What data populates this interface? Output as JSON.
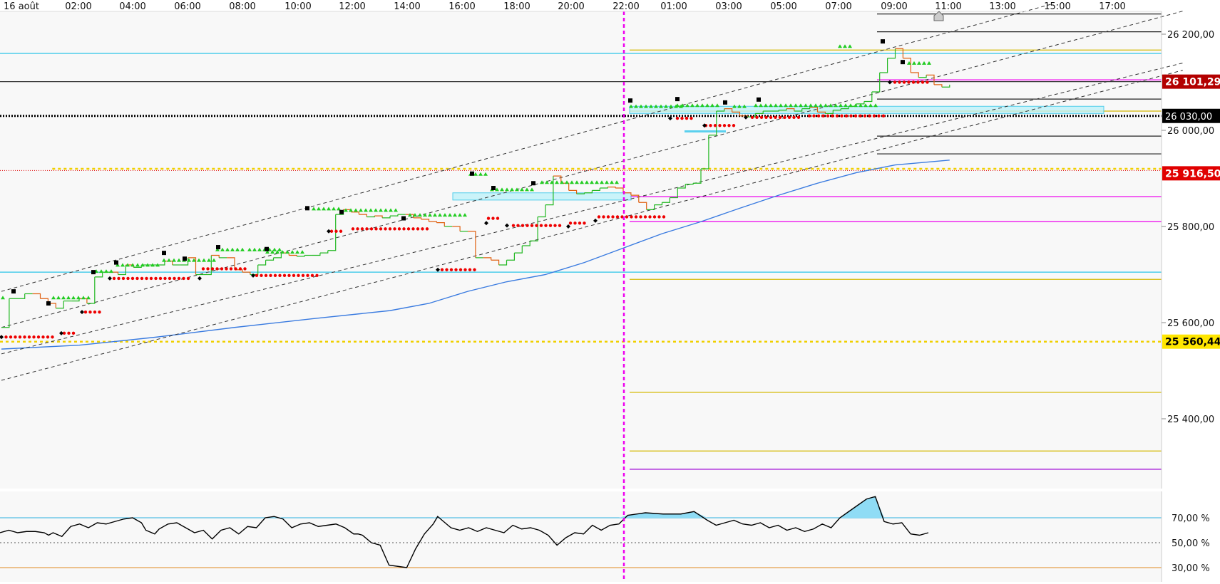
{
  "chart_data": {
    "type": "line",
    "x_tick_labels": [
      "16 août",
      "02:00",
      "04:00",
      "06:00",
      "08:00",
      "10:00",
      "12:00",
      "14:00",
      "16:00",
      "18:00",
      "20:00",
      "22:00",
      "01:00",
      "03:00",
      "05:00",
      "07:00",
      "09:00",
      "11:00",
      "13:00",
      "15:00",
      "17:00"
    ],
    "price_axis": {
      "tick_labels": [
        "26 200,00",
        "26 000,00",
        "25 800,00",
        "25 600,00",
        "25 400,00"
      ],
      "tick_values": [
        26200,
        26000,
        25800,
        25600,
        25400
      ]
    },
    "price_tags": [
      {
        "label": "26 101,29",
        "value": 26101.29,
        "bg": "#b30000",
        "fg": "#ffffff"
      },
      {
        "label": "26 030,00",
        "value": 26030,
        "bg": "#000000",
        "fg": "#ffffff"
      },
      {
        "label": "25 916,50",
        "value": 25916.5,
        "bg": "#e00000",
        "fg": "#ffffff"
      },
      {
        "label": "25 560,44",
        "value": 25560.44,
        "bg": "#ffe600",
        "fg": "#000000"
      }
    ],
    "horizontal_levels": [
      {
        "value": 26160,
        "color": "#2bc4e8",
        "style": "solid",
        "from": "start"
      },
      {
        "value": 26101.29,
        "color": "#333333",
        "style": "solid",
        "from": "start"
      },
      {
        "value": 26030,
        "color": "#000000",
        "style": "dotted-heavy",
        "from": "start"
      },
      {
        "value": 25920,
        "color": "#f0d000",
        "style": "dashed-yellow",
        "from": "x0.045"
      },
      {
        "value": 25916.5,
        "color": "#e00000",
        "style": "dotted-red",
        "from": "start"
      },
      {
        "value": 25705,
        "color": "#2bc4e8",
        "style": "solid",
        "from": "start"
      },
      {
        "value": 25560.44,
        "color": "#f0d000",
        "style": "dashed-yellow",
        "from": "start"
      },
      {
        "value": 26167,
        "color": "#d4b800",
        "style": "solid",
        "from": "session"
      },
      {
        "value": 26040,
        "color": "#d4b800",
        "style": "solid",
        "from": "session"
      },
      {
        "value": 25862,
        "color": "#ee00ee",
        "style": "solid",
        "from": "session"
      },
      {
        "value": 25810,
        "color": "#ee00ee",
        "style": "solid",
        "from": "session"
      },
      {
        "value": 25690,
        "color": "#d4b800",
        "style": "solid",
        "from": "session"
      },
      {
        "value": 25455,
        "color": "#d4b800",
        "style": "solid",
        "from": "session"
      },
      {
        "value": 25333,
        "color": "#d4b800",
        "style": "solid",
        "from": "session"
      },
      {
        "value": 25295,
        "color": "#9b00d4",
        "style": "solid",
        "from": "session"
      },
      {
        "value": 26105,
        "color": "#ee00ee",
        "style": "solid",
        "from": "late"
      },
      {
        "value": 26242,
        "color": "#222222",
        "style": "solid",
        "from": "late"
      },
      {
        "value": 26205,
        "color": "#222222",
        "style": "solid",
        "from": "late"
      },
      {
        "value": 26065,
        "color": "#222222",
        "style": "solid",
        "from": "late"
      },
      {
        "value": 25988,
        "color": "#222222",
        "style": "solid",
        "from": "late"
      },
      {
        "value": 25951,
        "color": "#222222",
        "style": "solid",
        "from": "late"
      }
    ],
    "session_break_label": "22:00",
    "series": [
      {
        "name": "",
        "color_up": "#22b822",
        "color_down": "#e06010",
        "points": [
          [
            0,
            25590
          ],
          [
            1,
            25650
          ],
          [
            3,
            25660
          ],
          [
            4,
            25660
          ],
          [
            5,
            25650
          ],
          [
            6,
            25640
          ],
          [
            7,
            25630
          ],
          [
            8,
            25645
          ],
          [
            9,
            25645
          ],
          [
            10,
            25650
          ],
          [
            11,
            25640
          ],
          [
            12,
            25695
          ],
          [
            13,
            25705
          ],
          [
            14,
            25705
          ],
          [
            15,
            25700
          ],
          [
            16,
            25720
          ],
          [
            17,
            25715
          ],
          [
            18,
            25720
          ],
          [
            19,
            25720
          ],
          [
            20,
            25720
          ],
          [
            21,
            25728
          ],
          [
            22,
            25720
          ],
          [
            23,
            25720
          ],
          [
            24,
            25735
          ],
          [
            25,
            25700
          ],
          [
            26,
            25700
          ],
          [
            27,
            25740
          ],
          [
            28,
            25735
          ],
          [
            29,
            25735
          ],
          [
            30,
            25710
          ],
          [
            31,
            25705
          ],
          [
            32,
            25700
          ],
          [
            33,
            25720
          ],
          [
            34,
            25730
          ],
          [
            35,
            25735
          ],
          [
            36,
            25745
          ],
          [
            37,
            25740
          ],
          [
            38,
            25738
          ],
          [
            39,
            25740
          ],
          [
            40,
            25740
          ],
          [
            41,
            25745
          ],
          [
            42,
            25750
          ],
          [
            43,
            25825
          ],
          [
            44,
            25835
          ],
          [
            45,
            25830
          ],
          [
            46,
            25825
          ],
          [
            47,
            25820
          ],
          [
            48,
            25822
          ],
          [
            49,
            25818
          ],
          [
            50,
            25822
          ],
          [
            51,
            25825
          ],
          [
            52,
            25825
          ],
          [
            53,
            25818
          ],
          [
            54,
            25815
          ],
          [
            55,
            25810
          ],
          [
            56,
            25808
          ],
          [
            57,
            25800
          ],
          [
            58,
            25800
          ],
          [
            59,
            25790
          ],
          [
            60,
            25790
          ],
          [
            61,
            25735
          ],
          [
            62,
            25735
          ],
          [
            63,
            25730
          ],
          [
            64,
            25720
          ],
          [
            65,
            25730
          ],
          [
            66,
            25745
          ],
          [
            67,
            25760
          ],
          [
            68,
            25770
          ],
          [
            69,
            25820
          ],
          [
            70,
            25845
          ],
          [
            71,
            25905
          ],
          [
            72,
            25890
          ],
          [
            73,
            25875
          ],
          [
            74,
            25868
          ],
          [
            75,
            25870
          ],
          [
            76,
            25875
          ],
          [
            77,
            25880
          ],
          [
            78,
            25882
          ],
          [
            79,
            25880
          ],
          [
            80,
            25870
          ],
          [
            81,
            25865
          ],
          [
            82,
            25850
          ],
          [
            83,
            25835
          ],
          [
            84,
            25845
          ],
          [
            85,
            25850
          ],
          [
            86,
            25860
          ],
          [
            87,
            25880
          ],
          [
            88,
            25888
          ],
          [
            89,
            25890
          ],
          [
            90,
            25920
          ],
          [
            91,
            25990
          ],
          [
            92,
            26040
          ],
          [
            93,
            26045
          ],
          [
            94,
            26038
          ],
          [
            95,
            26030
          ],
          [
            96,
            26028
          ],
          [
            97,
            26035
          ],
          [
            98,
            26040
          ],
          [
            99,
            26040
          ],
          [
            100,
            26042
          ],
          [
            101,
            26045
          ],
          [
            102,
            26040
          ],
          [
            103,
            26045
          ],
          [
            104,
            26048
          ],
          [
            105,
            26038
          ],
          [
            106,
            26035
          ],
          [
            107,
            26042
          ],
          [
            108,
            26045
          ],
          [
            109,
            26050
          ],
          [
            110,
            26055
          ],
          [
            111,
            26060
          ],
          [
            112,
            26080
          ],
          [
            113,
            26120
          ],
          [
            114,
            26150
          ],
          [
            115,
            26170
          ],
          [
            116,
            26150
          ],
          [
            117,
            26120
          ],
          [
            118,
            26110
          ],
          [
            119,
            26115
          ],
          [
            120,
            26095
          ],
          [
            121,
            26090
          ],
          [
            122,
            26095
          ]
        ]
      }
    ],
    "moving_average": {
      "name": "",
      "color": "#3a7be0",
      "points": [
        [
          0,
          25545
        ],
        [
          10,
          25553
        ],
        [
          20,
          25570
        ],
        [
          30,
          25590
        ],
        [
          40,
          25608
        ],
        [
          50,
          25625
        ],
        [
          55,
          25640
        ],
        [
          60,
          25665
        ],
        [
          65,
          25685
        ],
        [
          70,
          25700
        ],
        [
          75,
          25725
        ],
        [
          80,
          25755
        ],
        [
          85,
          25785
        ],
        [
          90,
          25810
        ],
        [
          95,
          25838
        ],
        [
          100,
          25865
        ],
        [
          105,
          25890
        ],
        [
          110,
          25912
        ],
        [
          115,
          25928
        ],
        [
          122,
          25938
        ]
      ]
    },
    "trend_channels": [
      {
        "from": [
          0,
          25665
        ],
        "to": [
          135,
          26262
        ]
      },
      {
        "from": [
          0,
          25590
        ],
        "to": [
          152,
          26248
        ]
      },
      {
        "from": [
          0,
          25535
        ],
        "to": [
          152,
          26140
        ]
      },
      {
        "from": [
          0,
          25480
        ],
        "to": [
          152,
          26125
        ]
      }
    ],
    "oscillator": {
      "type": "line",
      "levels": [
        "70,00 %",
        "50,00 %",
        "30,00 %"
      ],
      "level_values": [
        70,
        50,
        30
      ],
      "points": [
        [
          0,
          58
        ],
        [
          2,
          60
        ],
        [
          4,
          58
        ],
        [
          6,
          59
        ],
        [
          8,
          59
        ],
        [
          10,
          58
        ],
        [
          11,
          56
        ],
        [
          12,
          58
        ],
        [
          14,
          55
        ],
        [
          16,
          63
        ],
        [
          18,
          65
        ],
        [
          20,
          62
        ],
        [
          22,
          66
        ],
        [
          24,
          65
        ],
        [
          26,
          67
        ],
        [
          28,
          69
        ],
        [
          30,
          70
        ],
        [
          32,
          66
        ],
        [
          33,
          60
        ],
        [
          35,
          57
        ],
        [
          36,
          61
        ],
        [
          38,
          65
        ],
        [
          40,
          66
        ],
        [
          42,
          62
        ],
        [
          44,
          58
        ],
        [
          46,
          60
        ],
        [
          48,
          53
        ],
        [
          50,
          60
        ],
        [
          52,
          62
        ],
        [
          54,
          57
        ],
        [
          56,
          63
        ],
        [
          58,
          62
        ],
        [
          60,
          70
        ],
        [
          62,
          71
        ],
        [
          64,
          69
        ],
        [
          66,
          62
        ],
        [
          68,
          65
        ],
        [
          70,
          66
        ],
        [
          72,
          63
        ],
        [
          74,
          64
        ],
        [
          76,
          65
        ],
        [
          78,
          62
        ],
        [
          80,
          57
        ],
        [
          81,
          57
        ],
        [
          82,
          56
        ],
        [
          84,
          50
        ],
        [
          86,
          48
        ],
        [
          88,
          32
        ],
        [
          90,
          31
        ],
        [
          92,
          30
        ],
        [
          94,
          45
        ],
        [
          96,
          57
        ],
        [
          98,
          65
        ],
        [
          99,
          71
        ],
        [
          100,
          68
        ],
        [
          102,
          62
        ],
        [
          104,
          60
        ],
        [
          106,
          62
        ],
        [
          108,
          59
        ],
        [
          110,
          62
        ],
        [
          112,
          60
        ],
        [
          114,
          58
        ],
        [
          116,
          64
        ],
        [
          118,
          61
        ],
        [
          120,
          62
        ],
        [
          122,
          60
        ],
        [
          124,
          56
        ],
        [
          126,
          48
        ],
        [
          128,
          54
        ],
        [
          130,
          58
        ],
        [
          132,
          57
        ],
        [
          134,
          64
        ],
        [
          136,
          60
        ],
        [
          138,
          64
        ],
        [
          140,
          65
        ],
        [
          142,
          72
        ],
        [
          146,
          74
        ],
        [
          150,
          73
        ],
        [
          154,
          73
        ],
        [
          157,
          75
        ],
        [
          160,
          68
        ],
        [
          162,
          64
        ],
        [
          164,
          66
        ],
        [
          166,
          68
        ],
        [
          168,
          65
        ],
        [
          170,
          64
        ],
        [
          172,
          66
        ],
        [
          174,
          62
        ],
        [
          176,
          64
        ],
        [
          178,
          60
        ],
        [
          180,
          62
        ],
        [
          182,
          59
        ],
        [
          184,
          61
        ],
        [
          186,
          65
        ],
        [
          188,
          62
        ],
        [
          190,
          70
        ],
        [
          192,
          75
        ],
        [
          194,
          80
        ],
        [
          196,
          85
        ],
        [
          198,
          87
        ],
        [
          200,
          67
        ],
        [
          202,
          65
        ],
        [
          204,
          66
        ],
        [
          206,
          57
        ],
        [
          208,
          56
        ],
        [
          210,
          58
        ]
      ]
    }
  }
}
